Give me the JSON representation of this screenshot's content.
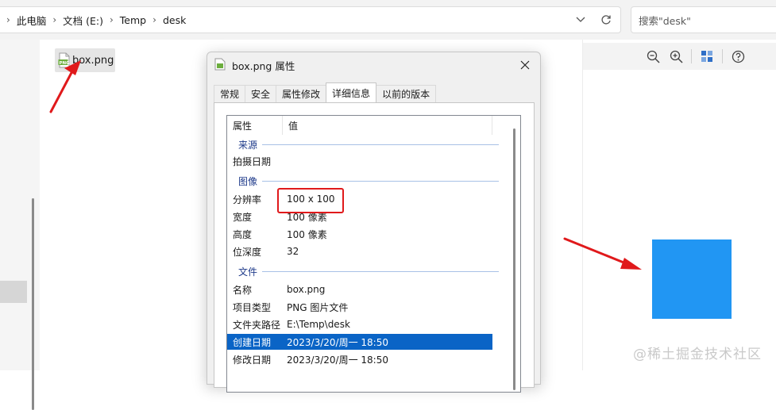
{
  "address_bar": {
    "crumbs": [
      "此电脑",
      "文档 (E:)",
      "Temp",
      "desk"
    ],
    "dropdown_icon": "chevron-down-icon",
    "refresh_icon": "refresh-icon"
  },
  "search": {
    "placeholder": "搜索\"desk\""
  },
  "file": {
    "name": "box.png",
    "icon": "png-file-icon"
  },
  "preview": {
    "toolbar_icons": [
      "zoom-out-icon",
      "zoom-in-icon",
      "grid-view-icon",
      "help-icon"
    ],
    "image_color": "#2196f3"
  },
  "dialog": {
    "title": "box.png 属性",
    "tabs": [
      "常规",
      "安全",
      "属性修改",
      "详细信息",
      "以前的版本"
    ],
    "active_tab": "详细信息",
    "columns": {
      "property": "属性",
      "value": "值"
    },
    "groups": {
      "source": "来源",
      "image": "图像",
      "file": "文件"
    },
    "rows": {
      "date_taken": {
        "k": "拍摄日期",
        "v": ""
      },
      "dimensions": {
        "k": "分辨率",
        "v": "100 x 100"
      },
      "width": {
        "k": "宽度",
        "v": "100 像素"
      },
      "height": {
        "k": "高度",
        "v": "100 像素"
      },
      "bit_depth": {
        "k": "位深度",
        "v": "32"
      },
      "name": {
        "k": "名称",
        "v": "box.png"
      },
      "item_type": {
        "k": "项目类型",
        "v": "PNG 图片文件"
      },
      "folder_path": {
        "k": "文件夹路径",
        "v": "E:\\Temp\\desk"
      },
      "date_created": {
        "k": "创建日期",
        "v": "2023/3/20/周一 18:50"
      },
      "date_modified": {
        "k": "修改日期",
        "v": "2023/3/20/周一 18:50"
      }
    }
  },
  "colors": {
    "selection": "#0a64c6",
    "annotation_red": "#e0191b",
    "group_label": "#1e3a8a"
  },
  "watermark": "@稀土掘金技术社区"
}
